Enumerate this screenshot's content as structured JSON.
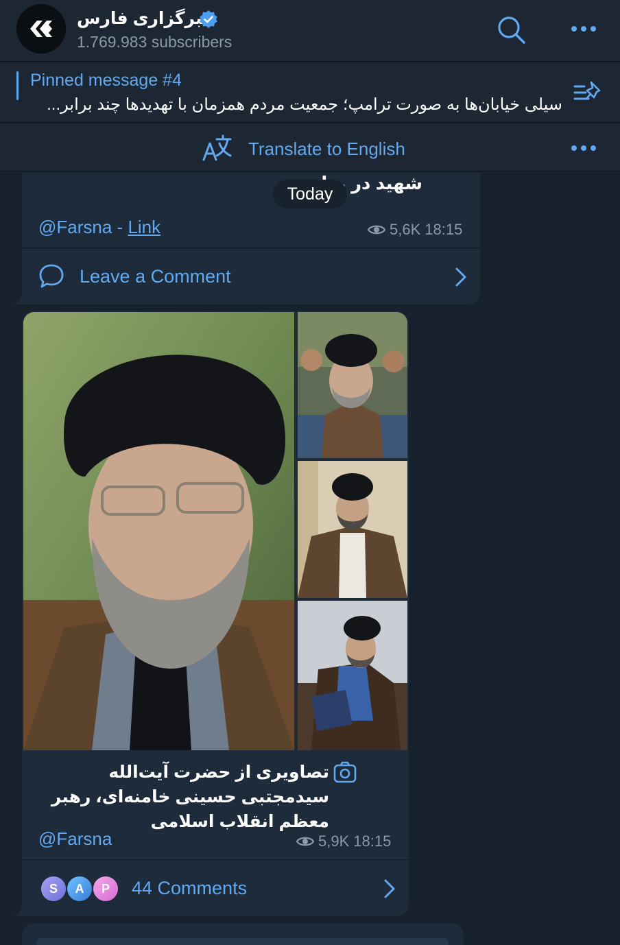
{
  "header": {
    "channel_name": "خبرگزاری فارس",
    "subscribers": "1.769.983 subscribers",
    "verified": true
  },
  "pinned": {
    "title": "Pinned message #4",
    "text": "سیلی خیابان‌ها به صورت ترامپ؛ جمعیت مردم همزمان با تهدیدها چند برابر..."
  },
  "translate": {
    "label": "Translate to English"
  },
  "message1": {
    "partial_text": "شهید در منا",
    "date_chip": "Today",
    "author": "@Farsna",
    "separator": " - ",
    "link_label": "Link",
    "views": "5,6K",
    "time": "18:15",
    "comment_label": "Leave a Comment"
  },
  "message2": {
    "caption": "تصاویری از حضرت آیت‌الله سیدمجتبی حسینی خامنه‌ای، رهبر معظم انقلاب اسلامی",
    "author": "@Farsna",
    "views": "5,9K",
    "time": "18:15",
    "commenter_initials": [
      "S",
      "A",
      "P"
    ],
    "comments_label": "44 Comments"
  },
  "colors": {
    "background": "#18222d",
    "bar": "#1c2733",
    "bubble": "#1d2b3b",
    "accent": "#62a9f0",
    "muted": "#8b9aa8"
  },
  "icons": [
    "logo-icon",
    "verified-icon",
    "search-icon",
    "more-icon",
    "pin-list-icon",
    "translate-icon",
    "comment-icon",
    "chevron-right-icon",
    "camera-icon",
    "eye-icon"
  ]
}
